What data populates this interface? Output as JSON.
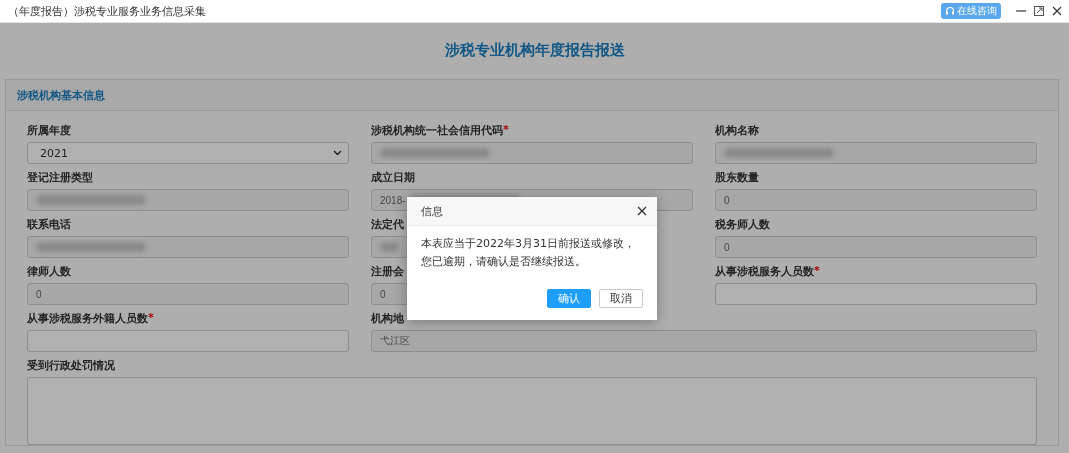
{
  "window": {
    "title": "（年度报告）涉税专业服务业务信息采集",
    "consult_button": "在线咨询"
  },
  "page": {
    "heading": "涉税专业机构年度报告报送"
  },
  "panel": {
    "title": "涉税机构基本信息",
    "fields": [
      {
        "kind": "select",
        "label": "所属年度",
        "value": "2021"
      },
      {
        "kind": "input",
        "label": "涉税机构统一社会信用代码",
        "required_mark": "*",
        "redacted": true
      },
      {
        "kind": "input",
        "label": "机构名称",
        "redacted": true
      },
      {
        "kind": "input",
        "label": "登记注册类型",
        "redacted": true
      },
      {
        "kind": "input",
        "label": "成立日期",
        "value": "2018-",
        "redacted": true
      },
      {
        "kind": "input",
        "label": "股东数量",
        "value": "0"
      },
      {
        "kind": "input",
        "label": "联系电话",
        "redacted": true
      },
      {
        "kind": "input",
        "label": "法定代",
        "redacted": true
      },
      {
        "kind": "input",
        "label": "税务师人数",
        "value": "0"
      },
      {
        "kind": "input",
        "label": "律师人数",
        "value": "0"
      },
      {
        "kind": "input",
        "label": "注册会",
        "value": "0"
      },
      {
        "kind": "input",
        "label": "从事涉税服务人员数",
        "required_mark": "*"
      },
      {
        "kind": "input",
        "label": "从事涉税服务外籍人员数",
        "required_mark": "*"
      },
      {
        "kind": "wide",
        "label": "机构地",
        "value": "弋江区"
      },
      {
        "kind": "textarea",
        "label": "受到行政处罚情况"
      }
    ]
  },
  "dialog": {
    "title": "信息",
    "message": "本表应当于2022年3月31日前报送或修改，您已逾期，请确认是否继续报送。",
    "buttons": [
      {
        "label": "确认",
        "kind": "primary"
      },
      {
        "label": "取消",
        "kind": "secondary"
      }
    ]
  }
}
